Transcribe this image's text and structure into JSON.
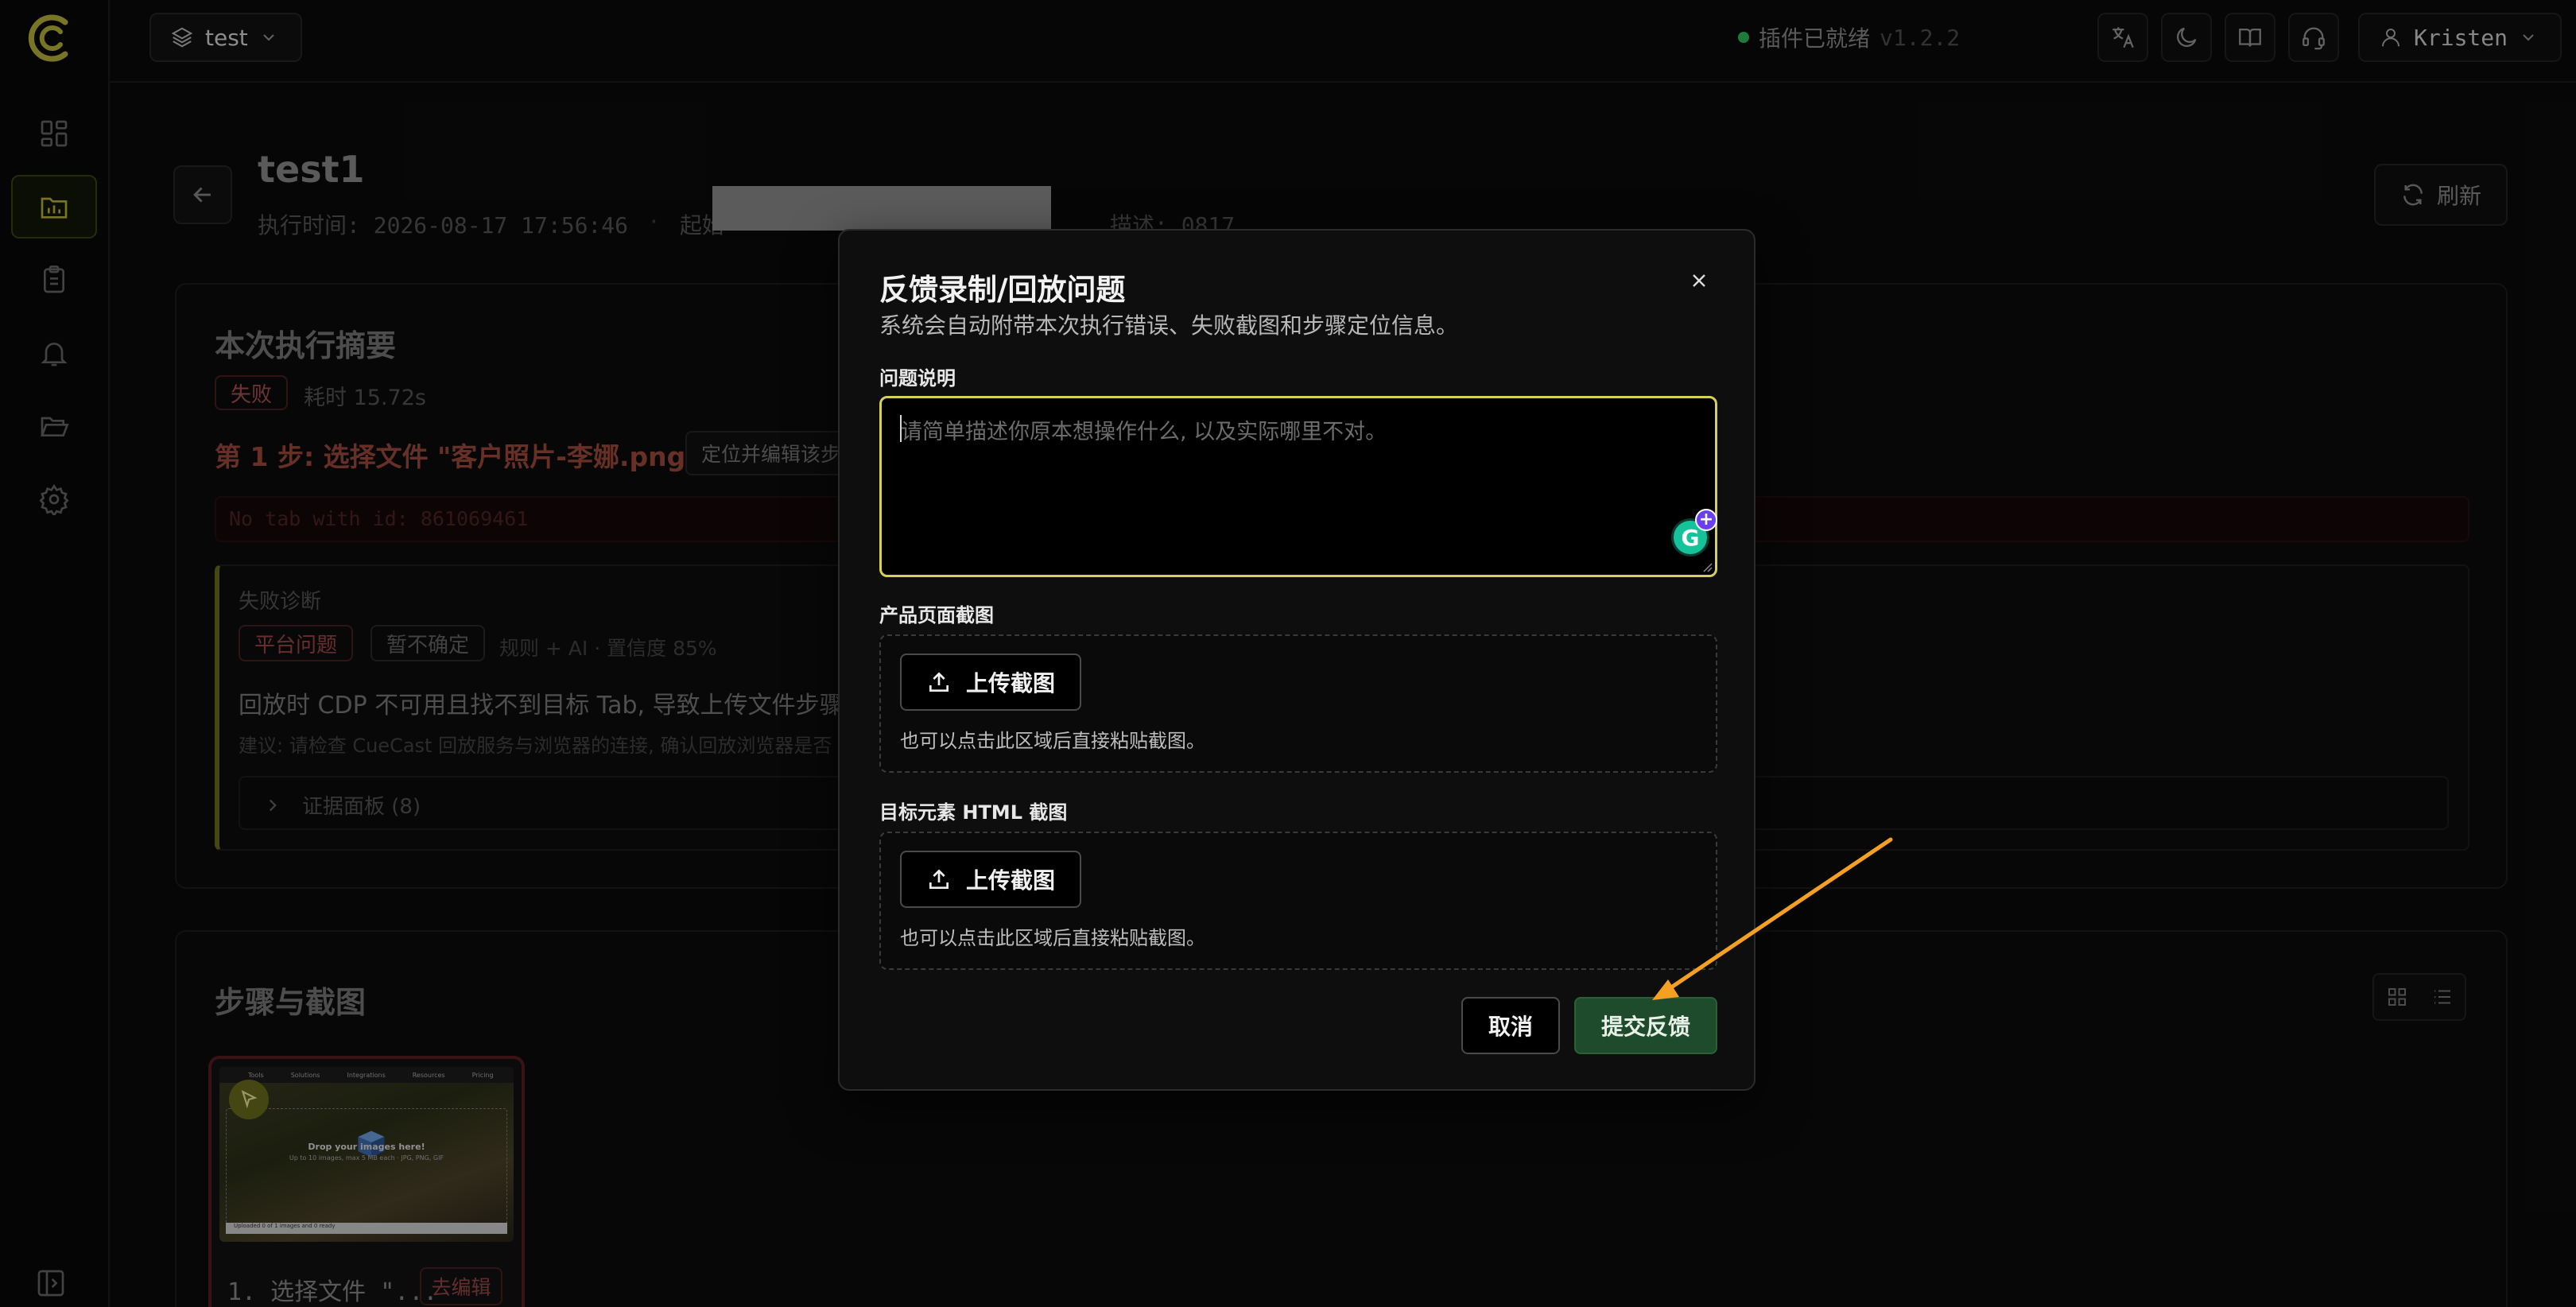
{
  "topbar": {
    "project": "test",
    "status_text": "插件已就绪",
    "version": "v1.2.2",
    "user": "Kristen"
  },
  "header": {
    "title": "test1",
    "exec_time": "执行时间: 2026-08-17 17:56:46",
    "start_label": "起始",
    "desc": "描述: 0817",
    "refresh": "刷新"
  },
  "summary": {
    "title": "本次执行摘要",
    "status_badge": "失败",
    "elapsed": "耗时 15.72s",
    "step": "第 1 步: 选择文件 \"客户照片-李娜.png\"",
    "locate_button": "定位并编辑该步骤",
    "error": "No tab with id: 861069461",
    "diagnosis": {
      "label": "失败诊断",
      "tag_platform": "平台问题",
      "tag_unsure": "暂不确定",
      "rule": "规则 + AI · 置信度 85%",
      "main": "回放时 CDP 不可用且找不到目标 Tab, 导致上传文件步骤无法",
      "hint": "建议: 请检查 CueCast 回放服务与浏览器的连接, 确认回放浏览器是否",
      "evidence": "证据面板 (8)"
    }
  },
  "steps": {
    "title": "步骤与截图",
    "items": [
      {
        "caption": "1. 选择文件 \"...",
        "edit": "去编辑",
        "thumb_nav": [
          "Tools",
          "Solutions",
          "Integrations",
          "Resources",
          "Pricing"
        ],
        "thumb_title": "Drop your images here!",
        "thumb_sub": "Up to 10 images, max 5 MB each · JPG, PNG, GIF",
        "thumb_bar": "Uploaded 0 of 1 images and 0 ready"
      }
    ]
  },
  "modal": {
    "title": "反馈录制/回放问题",
    "subtitle": "系统会自动附带本次执行错误、失败截图和步骤定位信息。",
    "desc_label": "问题说明",
    "desc_placeholder": "请简单描述你原本想操作什么, 以及实际哪里不对。",
    "page_shot_label": "产品页面截图",
    "element_shot_label": "目标元素 HTML 截图",
    "upload_label": "上传截图",
    "paste_hint": "也可以点击此区域后直接粘贴截图。",
    "cancel": "取消",
    "submit": "提交反馈"
  },
  "colors": {
    "accent": "#d8cf5a",
    "submit_bg": "#1d4b2c",
    "fail": "#a85252",
    "arrow": "#f5a020"
  }
}
